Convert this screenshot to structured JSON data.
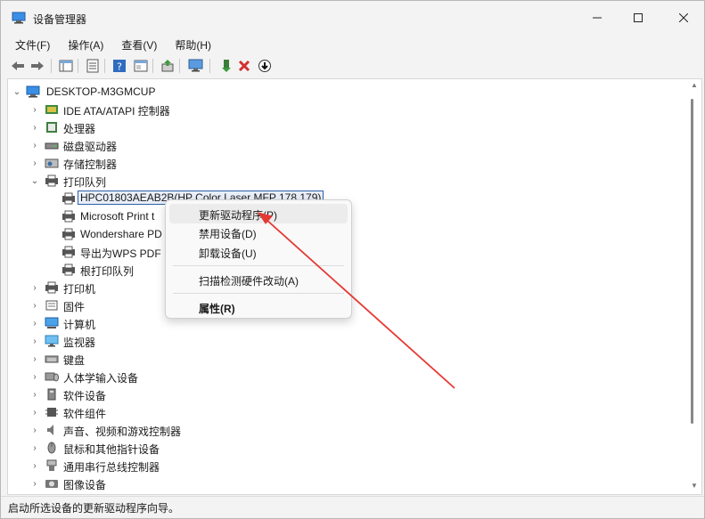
{
  "window": {
    "title": "设备管理器",
    "minimize_icon": "minimize-icon",
    "maximize_icon": "maximize-icon",
    "close_icon": "close-icon"
  },
  "menu": [
    "文件(F)",
    "操作(A)",
    "查看(V)",
    "帮助(H)"
  ],
  "toolbar": {
    "buttons": [
      "back-icon",
      "forward-icon",
      "show-hide-console-tree-icon",
      "properties-icon",
      "help-icon",
      "properties-sheet-icon",
      "update-driver-icon",
      "scan-hardware-icon",
      "enable-device-icon",
      "uninstall-icon",
      "disable-download-icon"
    ]
  },
  "tree": {
    "root": "DESKTOP-M3GMCUP",
    "items": [
      {
        "label": "IDE ATA/ATAPI 控制器",
        "icon": "ide-controller-icon"
      },
      {
        "label": "处理器",
        "icon": "processor-icon"
      },
      {
        "label": "磁盘驱动器",
        "icon": "disk-drive-icon"
      },
      {
        "label": "存储控制器",
        "icon": "storage-controller-icon"
      },
      {
        "label": "打印队列",
        "icon": "print-queue-icon"
      },
      {
        "label": "HPC01803AEAB2B(HP Color Laser MFP 178 179)",
        "icon": "printer-icon"
      },
      {
        "label": "Microsoft Print t",
        "icon": "printer-icon"
      },
      {
        "label": "Wondershare PD",
        "icon": "printer-icon"
      },
      {
        "label": "导出为WPS PDF",
        "icon": "printer-icon"
      },
      {
        "label": "根打印队列",
        "icon": "printer-icon"
      },
      {
        "label": "打印机",
        "icon": "printer-icon"
      },
      {
        "label": "固件",
        "icon": "firmware-icon"
      },
      {
        "label": "计算机",
        "icon": "computer-icon"
      },
      {
        "label": "监视器",
        "icon": "monitor-icon"
      },
      {
        "label": "键盘",
        "icon": "keyboard-icon"
      },
      {
        "label": "人体学输入设备",
        "icon": "hid-icon"
      },
      {
        "label": "软件设备",
        "icon": "software-device-icon"
      },
      {
        "label": "软件组件",
        "icon": "software-component-icon"
      },
      {
        "label": "声音、视频和游戏控制器",
        "icon": "sound-icon"
      },
      {
        "label": "鼠标和其他指针设备",
        "icon": "mouse-icon"
      },
      {
        "label": "通用串行总线控制器",
        "icon": "usb-icon"
      },
      {
        "label": "图像设备",
        "icon": "camera-icon"
      }
    ]
  },
  "context_menu": {
    "items": [
      "更新驱动程序(P)",
      "禁用设备(D)",
      "卸载设备(U)",
      "扫描检测硬件改动(A)",
      "属性(R)"
    ]
  },
  "status": "启动所选设备的更新驱动程序向导。",
  "colors": {
    "annotation_arrow": "#e53935",
    "selection_border": "#2f5fa8"
  }
}
